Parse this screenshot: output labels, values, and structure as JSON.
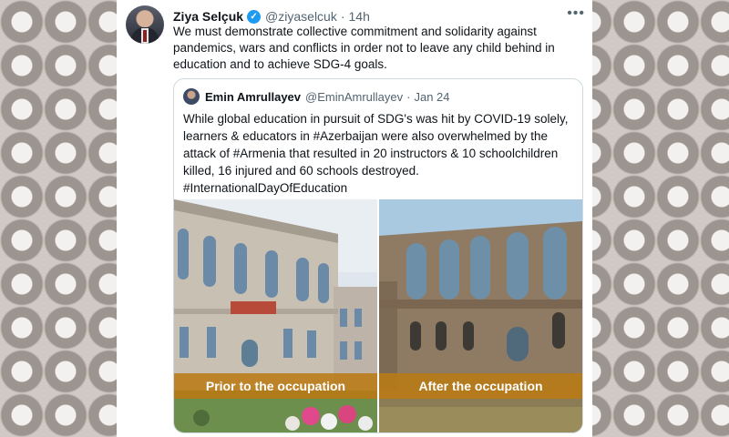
{
  "tweet": {
    "author_name": "Ziya Selçuk",
    "verified_mark": "✓",
    "handle": "@ziyaselcuk",
    "separator": "·",
    "time": "14h",
    "more_icon": "•••",
    "text": "We must demonstrate collective commitment and solidarity against pandemics, wars and conflicts in order not to leave any child behind in education and to achieve SDG-4 goals."
  },
  "quoted": {
    "author_name": "Emin Amrullayev",
    "handle": "@EminAmrullayev",
    "separator": "·",
    "date": "Jan 24",
    "text_line1": "While global education in pursuit of SDG's was hit by COVID-19 solely, learners & educators in #Azerbaijan were also overwhelmed by the attack of #Armenia that resulted in 20 instructors & 10 schoolchildren killed, 16 injured and 60 schools destroyed.",
    "text_line2": "#InternationalDayOfEducation",
    "image_left_caption": "Prior to the occupation",
    "image_right_caption": "After the occupation"
  },
  "colors": {
    "accent": "#1d9bf0",
    "caption_bg": "#ba7a14",
    "secondary_text": "#536471"
  }
}
